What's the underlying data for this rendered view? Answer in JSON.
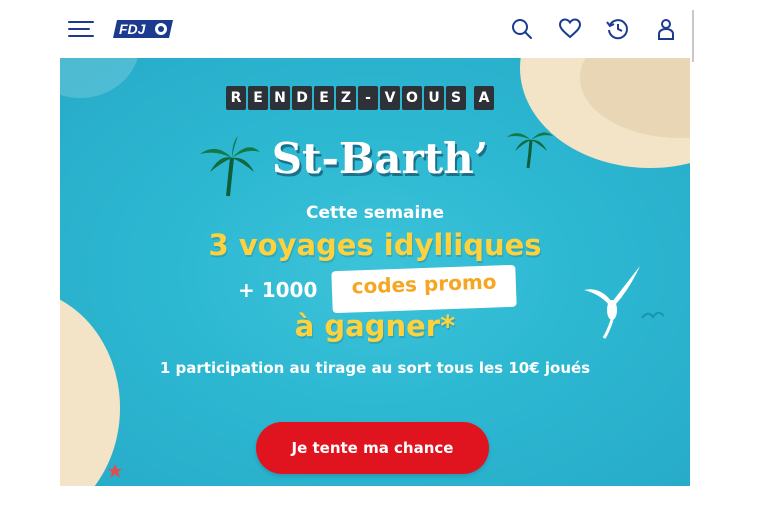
{
  "header": {
    "menu_icon": "hamburger-menu-icon",
    "logo_text": "FDJ",
    "icons": [
      "search-icon",
      "heart-icon",
      "history-icon",
      "user-icon"
    ],
    "brand_color": "#1c3b8f"
  },
  "banner": {
    "rdv_letters": [
      "R",
      "E",
      "N",
      "D",
      "E",
      "Z",
      "-",
      "V",
      "O",
      "U",
      "S",
      "",
      "A"
    ],
    "destination": "St-Barth’",
    "line1": "Cette semaine",
    "line2": "3 voyages idylliques",
    "line3_prefix": "+ 1000",
    "line3_highlight": "codes promo",
    "line4": "à gagner*",
    "line5": "1 participation au tirage au sort tous les 10€ joués",
    "cta_label": "Je tente ma chance",
    "colors": {
      "sea": "#2db8d2",
      "yellow": "#ffd23c",
      "orange": "#f5a623",
      "cta": "#e0141e"
    }
  }
}
